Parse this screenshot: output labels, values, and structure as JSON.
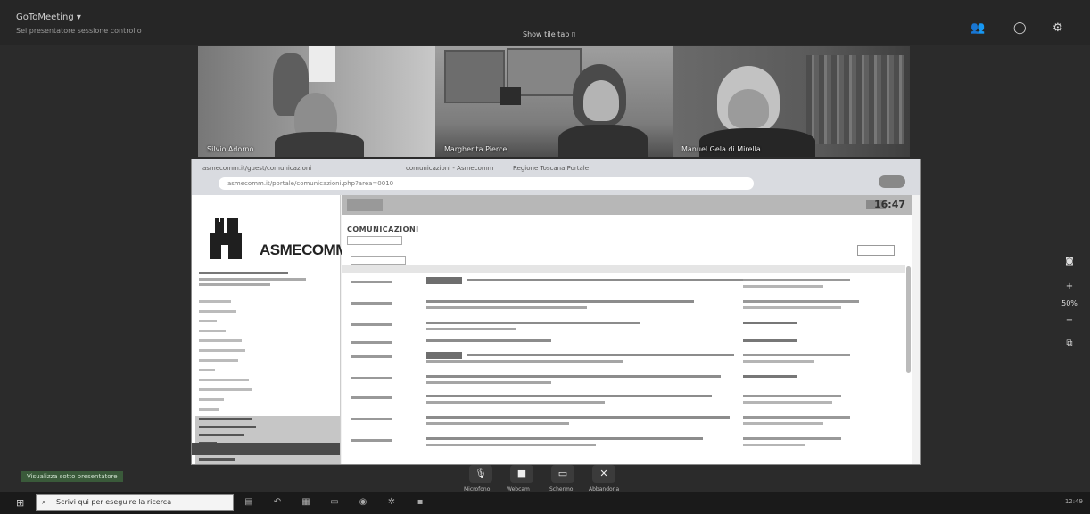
{
  "meeting": {
    "title": "GoToMeeting ▾",
    "subtitle": "Sei presentatore sessione controllo"
  },
  "header": {
    "view_label": "Show tile tab ▯"
  },
  "participants": [
    {
      "name": "Silvio Adorno"
    },
    {
      "name": "Margherita Pierce"
    },
    {
      "name": "Manuel Gela di Mirella"
    }
  ],
  "shared_screen": {
    "browser_tabs": [
      "asmecomm.it/guest/comunicazioni",
      "comunicazioni - Asmecomm",
      "Regione Toscana Portale"
    ],
    "url": "asmecomm.it/portale/comunicazioni.php?area=0010",
    "logo_text": "ASMECOMM",
    "section_title": "COMUNICAZIONI",
    "clock": "16:47"
  },
  "controls": {
    "mic_label": "Microfono",
    "camera_label": "Webcam",
    "screen_label": "Schermo",
    "leave_label": "Abbandona"
  },
  "side_rail": {
    "zoom": "50%"
  },
  "presenter_badge": "Visualizza sotto presentatore",
  "taskbar": {
    "search_placeholder": "Scrivi qui per eseguire la ricerca",
    "clock": "12:49"
  },
  "colors": {
    "background": "#2b2b2b",
    "taskbar": "#1a1a1a",
    "page_header": "#b7b7b7"
  }
}
